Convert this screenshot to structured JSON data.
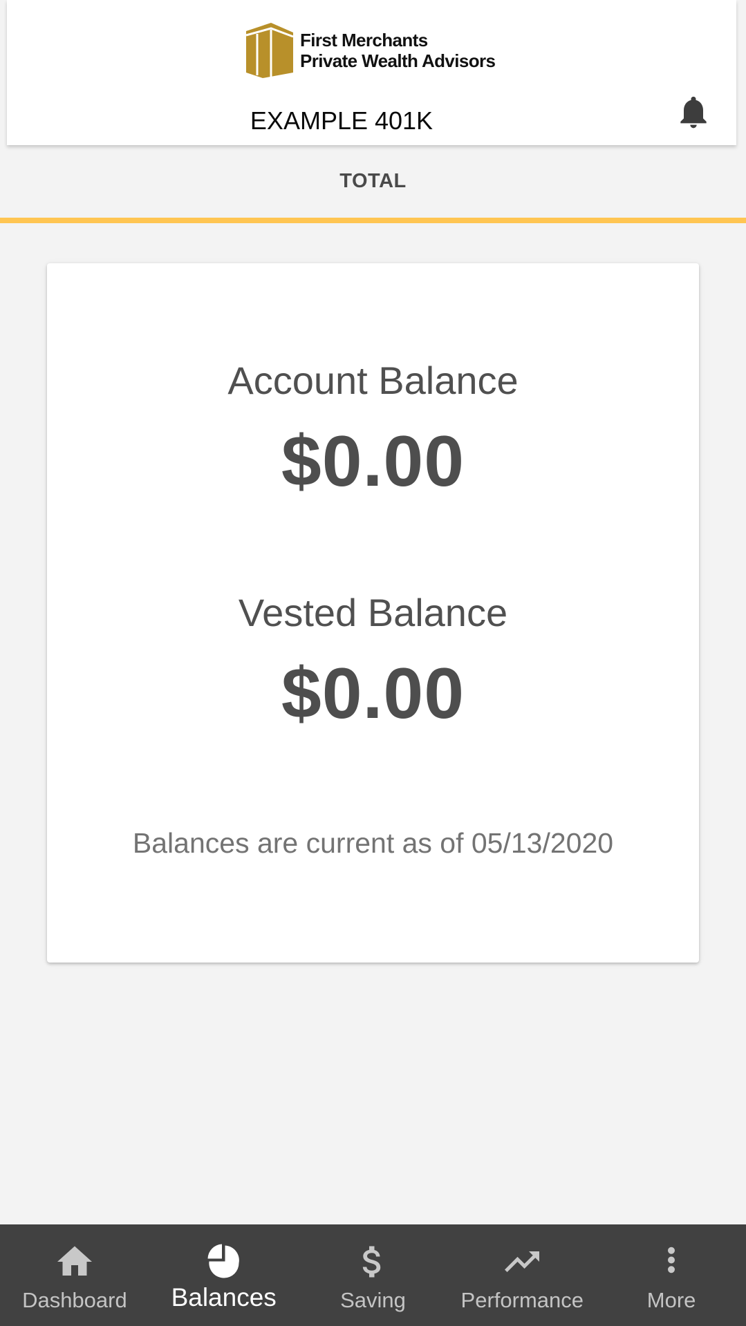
{
  "header": {
    "brand": {
      "line1": "First Merchants",
      "line2": "Private Wealth Advisors",
      "color": "#B8902A"
    },
    "account_title": "EXAMPLE 401K",
    "notifications_icon": "bell-icon"
  },
  "tabs": [
    {
      "label": "TOTAL",
      "active": true
    }
  ],
  "accent_color": "#FFC552",
  "card": {
    "account_balance": {
      "label": "Account Balance",
      "value": "$0.00"
    },
    "vested_balance": {
      "label": "Vested Balance",
      "value": "$0.00"
    },
    "as_of_text": "Balances are current as of 05/13/2020"
  },
  "bottom_nav": {
    "items": [
      {
        "label": "Dashboard",
        "icon": "home-icon",
        "active": false
      },
      {
        "label": "Balances",
        "icon": "pie-chart-icon",
        "active": true
      },
      {
        "label": "Saving",
        "icon": "dollar-icon",
        "active": false
      },
      {
        "label": "Performance",
        "icon": "trending-up-icon",
        "active": false
      },
      {
        "label": "More",
        "icon": "more-vertical-icon",
        "active": false
      }
    ]
  }
}
